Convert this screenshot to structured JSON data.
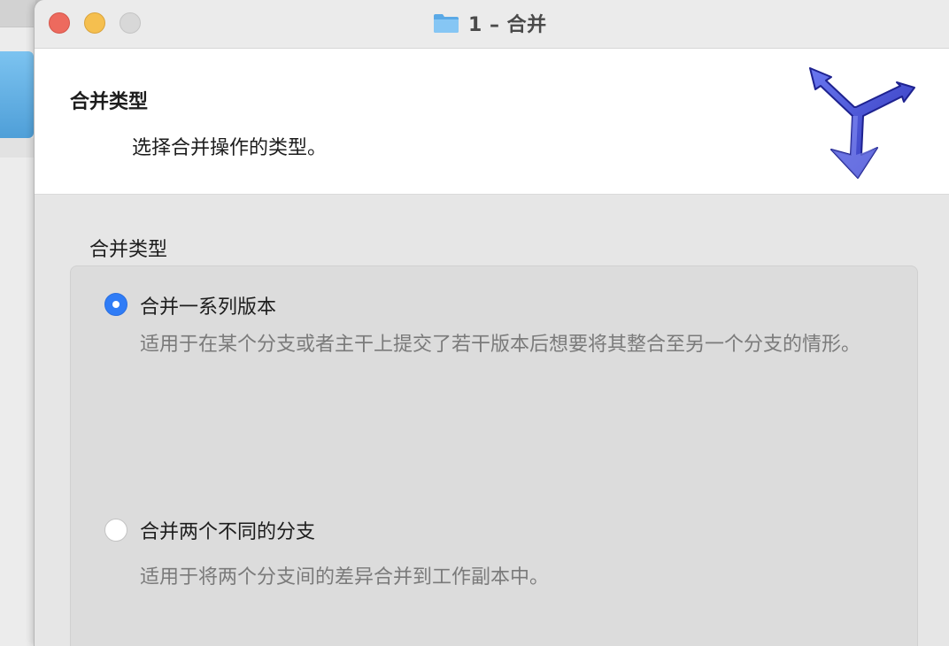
{
  "window": {
    "title": "1 – 合并"
  },
  "header": {
    "title": "合并类型",
    "subtitle": "选择合并操作的类型。"
  },
  "merge_type_group": {
    "label": "合并类型",
    "options": [
      {
        "label": "合并一系列版本",
        "description": "适用于在某个分支或者主干上提交了若干版本后想要将其整合至另一个分支的情形。",
        "selected": true
      },
      {
        "label": "合并两个不同的分支",
        "description": "适用于将两个分支间的差异合并到工作副本中。",
        "selected": false
      }
    ]
  },
  "colors": {
    "close": "#ed6a5e",
    "minimize": "#f5bf4f",
    "zoom": "#d8d8d8",
    "radio_selected": "#2f7cf6",
    "logo": "#3b3fc4"
  },
  "icons": {
    "title": "folder-icon",
    "header": "merge-arrow-icon"
  }
}
